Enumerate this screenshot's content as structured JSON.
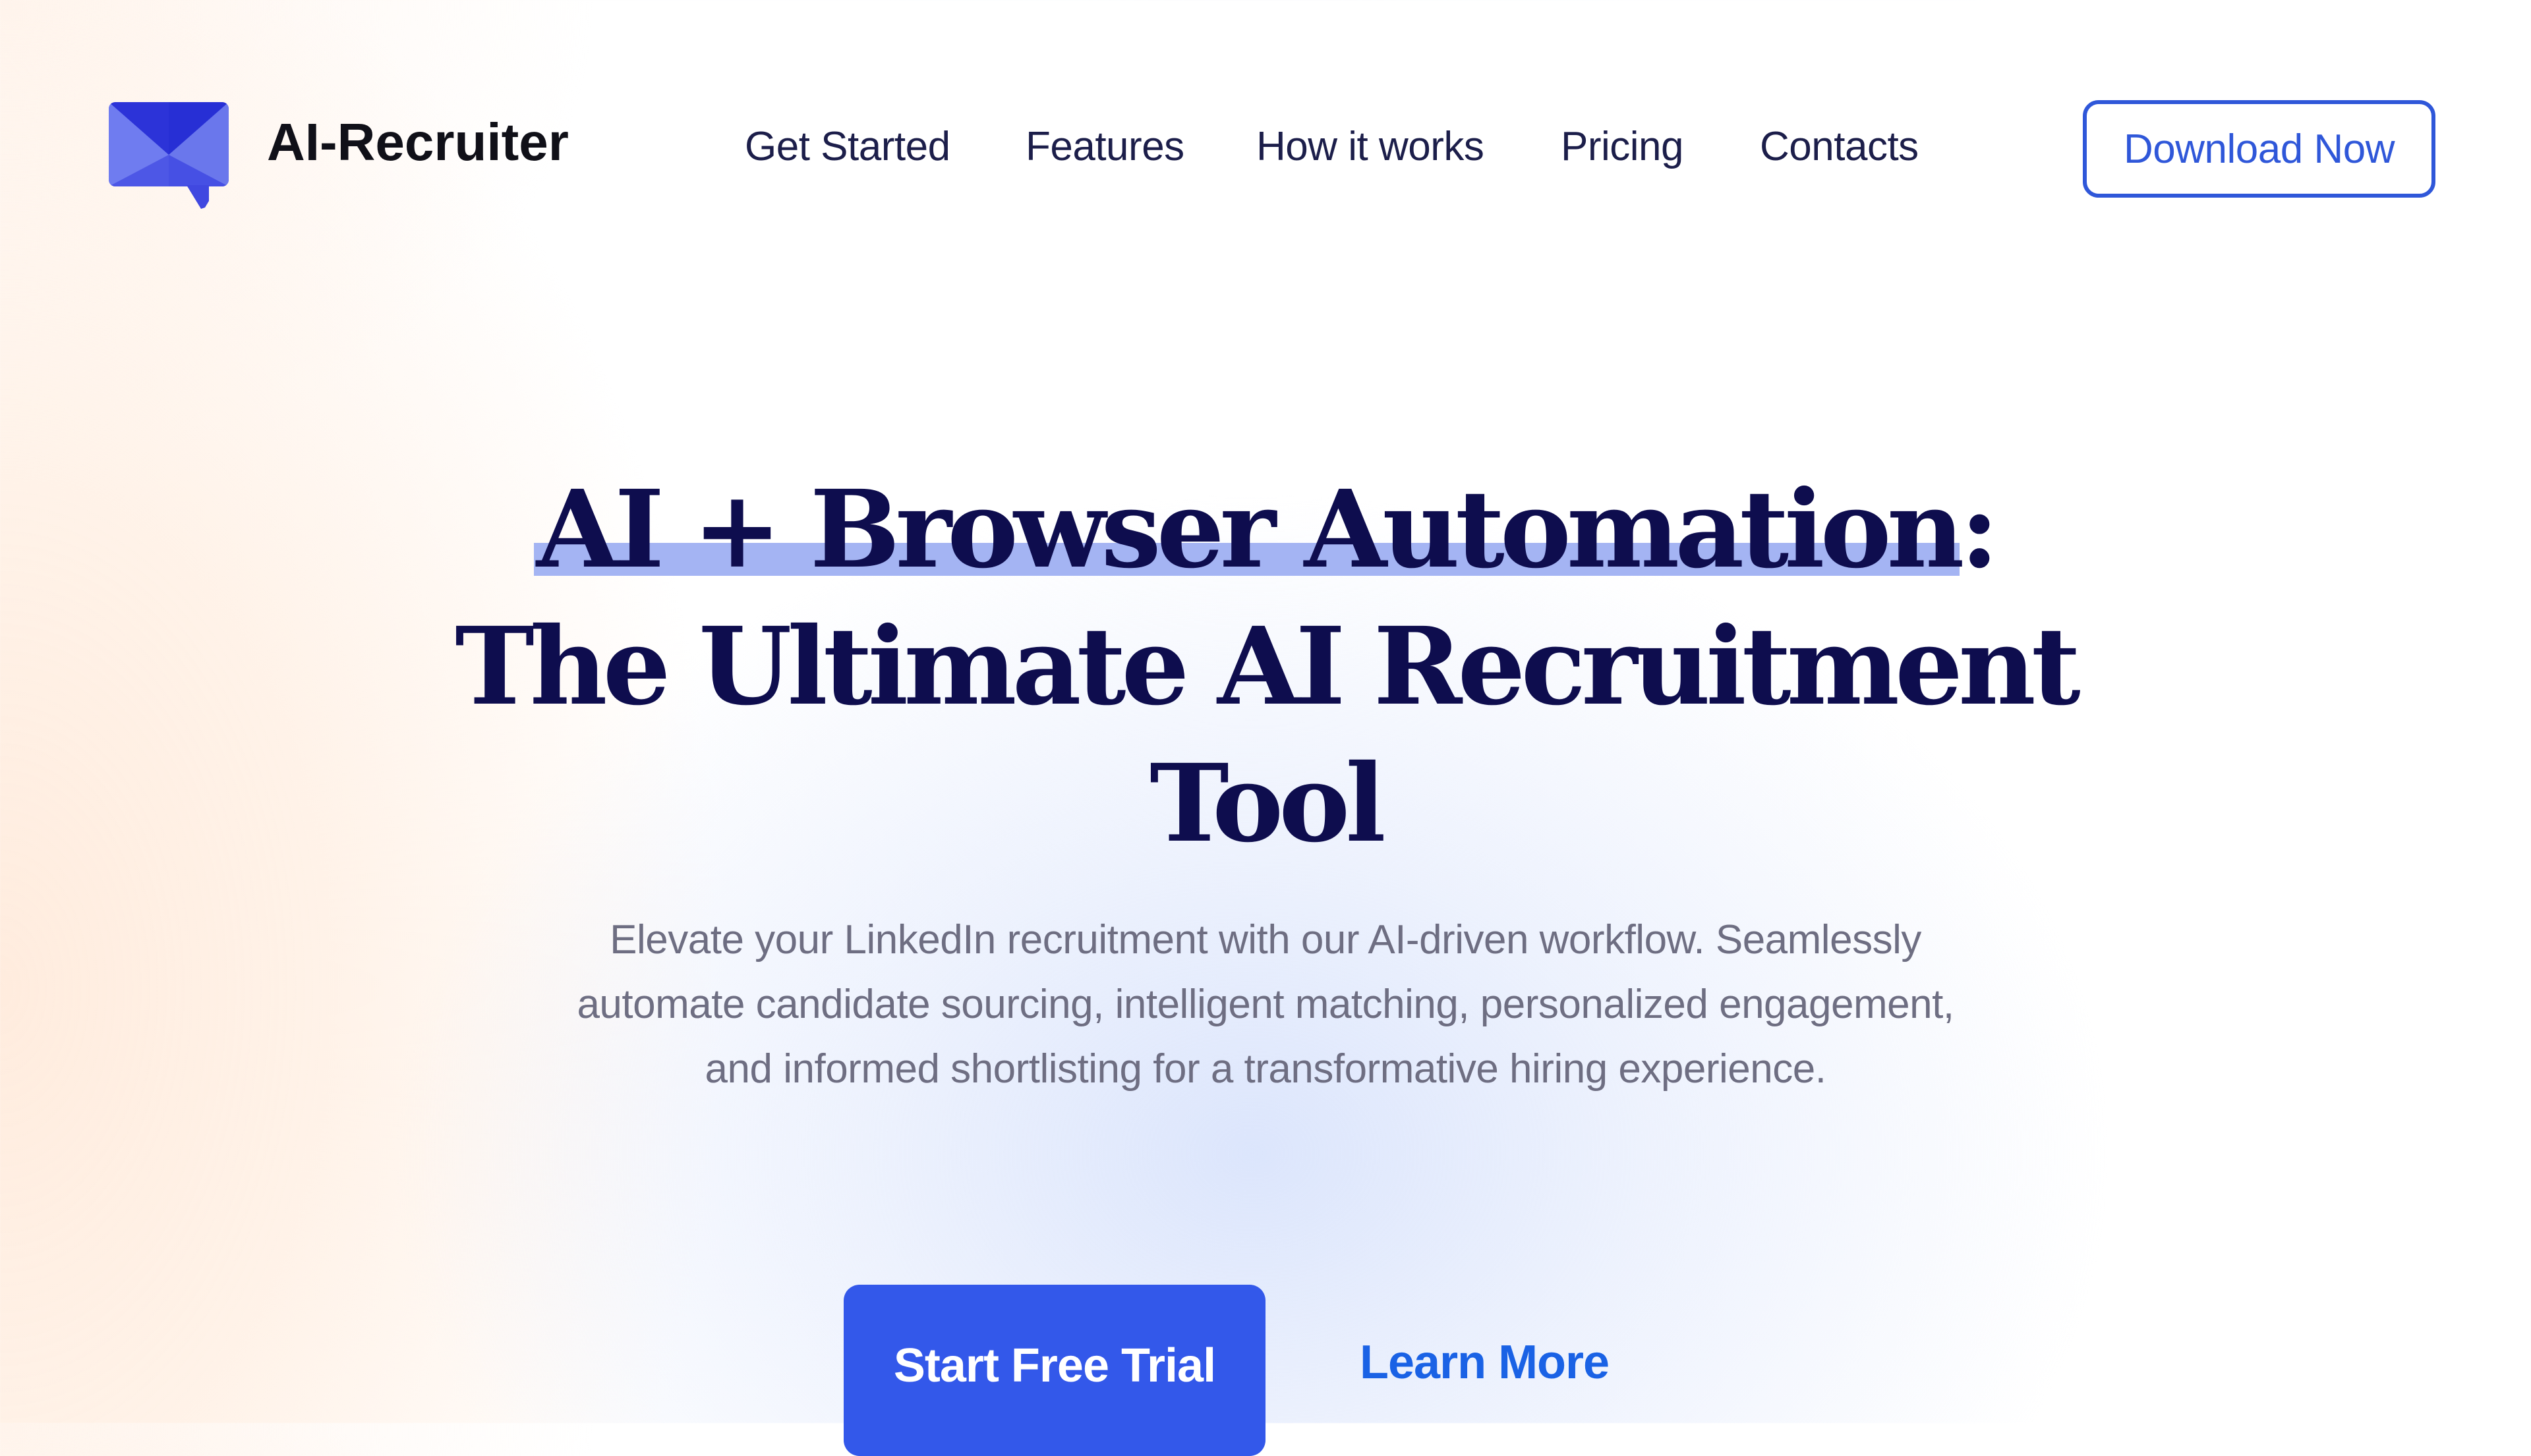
{
  "header": {
    "brand_name": "AI-Recruiter",
    "logo_icon": "chat-envelope-icon",
    "nav": [
      {
        "label": "Get Started"
      },
      {
        "label": "Features"
      },
      {
        "label": "How it works"
      },
      {
        "label": "Pricing"
      },
      {
        "label": "Contacts"
      }
    ],
    "download_label": "Download Now"
  },
  "hero": {
    "headline": {
      "line1_highlight": "AI + Browser Automation",
      "line1_suffix": ":",
      "line2": "The Ultimate AI Recruitment",
      "line3": "Tool"
    },
    "subtitle": "Elevate your LinkedIn recruitment with our AI-driven workflow. Seamlessly automate candidate sourcing, intelligent matching, personalized engagement, and informed shortlisting for a transformative hiring experience.",
    "primary_cta": "Start Free Trial",
    "secondary_cta": "Learn More"
  },
  "colors": {
    "brand_blue": "#3358ea",
    "outline_blue": "#2f57d9",
    "link_blue": "#1a62e5",
    "headline_navy": "#0e0d4e",
    "highlight": "#a4b4f3",
    "body_gray": "#6e6e82",
    "bg_peach": "#fff0e4",
    "bg_lavender": "#e4ebfc"
  }
}
